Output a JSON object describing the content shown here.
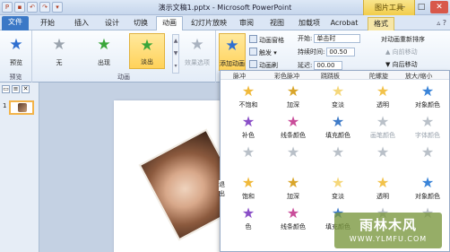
{
  "window": {
    "title": "演示文稿1.pptx - Microsoft PowerPoint",
    "context_group": "图片工具"
  },
  "tabs": [
    {
      "label": "文件"
    },
    {
      "label": "开始"
    },
    {
      "label": "插入"
    },
    {
      "label": "设计"
    },
    {
      "label": "切换"
    },
    {
      "label": "动画"
    },
    {
      "label": "幻灯片放映"
    },
    {
      "label": "审阅"
    },
    {
      "label": "视图"
    },
    {
      "label": "加载项"
    },
    {
      "label": "Acrobat"
    },
    {
      "label": "格式"
    }
  ],
  "ribbon": {
    "preview": {
      "label": "预览",
      "group": "预览"
    },
    "animation_group": {
      "label": "动画",
      "none": "无",
      "appear": "出现",
      "fade": "淡出",
      "effect_options": "效果选项"
    },
    "add_animation": "添加动画",
    "animation_pane": "动画窗格",
    "trigger": "触发",
    "animation_painter": "动画刷",
    "start_label": "开始:",
    "start_value": "单击时",
    "duration_label": "持续时间:",
    "duration_value": "00.50",
    "delay_label": "延迟:",
    "delay_value": "00.00",
    "reorder_title": "对动画重新排序",
    "move_earlier": "向前移动",
    "move_later": "向后移动"
  },
  "gallery": {
    "header": [
      "脉冲",
      "彩色脉冲",
      "跷跷板",
      "陀螺旋",
      "放大/缩小"
    ],
    "effects": [
      {
        "label": "不饱和",
        "color": "#f0b93a"
      },
      {
        "label": "加深",
        "color": "#d9a52a"
      },
      {
        "label": "变淡",
        "color": "#f5d77a"
      },
      {
        "label": "透明",
        "color": "#f2c24a"
      },
      {
        "label": "对象颜色",
        "color": "#3a84d8"
      },
      {
        "label": "补色",
        "color": "#8a4fc7"
      },
      {
        "label": "线条颜色",
        "color": "#c94d9a"
      },
      {
        "label": "填充颜色",
        "color": "#3f7bc8"
      },
      {
        "label": "画笔颜色",
        "color": "#b9c0c8"
      },
      {
        "label": "字体颜色",
        "color": "#b9c0c8"
      },
      {
        "label": "",
        "color": "#b9c0c8"
      },
      {
        "label": "",
        "color": "#b9c0c8"
      },
      {
        "label": "",
        "color": "#b9c0c8"
      },
      {
        "label": "",
        "color": "#b9c0c8"
      },
      {
        "label": "",
        "color": "#b9c0c8"
      },
      {
        "label": "饱和",
        "color": "#f0b93a"
      },
      {
        "label": "加深",
        "color": "#d9a52a"
      },
      {
        "label": "变淡",
        "color": "#f5d77a"
      },
      {
        "label": "透明",
        "color": "#f2c24a"
      },
      {
        "label": "对象颜色",
        "color": "#3a84d8"
      },
      {
        "label": "色",
        "color": "#8a4fc7"
      },
      {
        "label": "线条颜色",
        "color": "#c94d9a"
      },
      {
        "label": "填充颜色",
        "color": "#3f7bc8"
      },
      {
        "label": "",
        "color": "#b9c0c8"
      },
      {
        "label": "",
        "color": "#b9c0c8"
      }
    ],
    "side_label": "退出"
  },
  "slide_panel": {
    "slide_number": "1"
  },
  "watermark": {
    "name": "雨林木风",
    "url": "WWW.YLMFU.COM"
  },
  "colors": {
    "accent": "#3b78c6",
    "selected": "#ffd25a"
  }
}
